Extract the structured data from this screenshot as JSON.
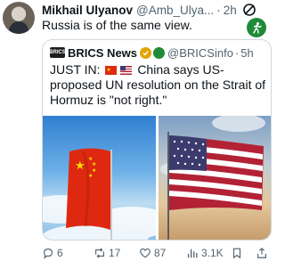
{
  "post": {
    "author_name": "Mikhail Ulyanov",
    "author_handle": "@Amb_Ulya...",
    "separator": "·",
    "time": "2h",
    "text": "Russia is of the same view."
  },
  "quote": {
    "logo_text": "BRICS",
    "name": "BRICS News",
    "handle": "@BRICSinfo",
    "separator": "·",
    "time": "5h",
    "text_prefix": "JUST IN:",
    "text_body": "China says US-proposed UN resolution on the Strait of Hormuz is \"not right.\""
  },
  "actions": {
    "replies": "6",
    "reposts": "17",
    "likes": "87",
    "views": "3.1K"
  },
  "colors": {
    "accent": "#1d9bf0",
    "muted": "#536471",
    "verified_gold": "#e2a500",
    "affiliate_green": "#1f8b3a",
    "border": "#cfd9de"
  },
  "icons": [
    "avatar",
    "grok-icon",
    "affiliate-badge-icon",
    "verified-gold-icon",
    "reply-icon",
    "repost-icon",
    "like-icon",
    "views-icon",
    "bookmark-icon",
    "share-icon"
  ]
}
